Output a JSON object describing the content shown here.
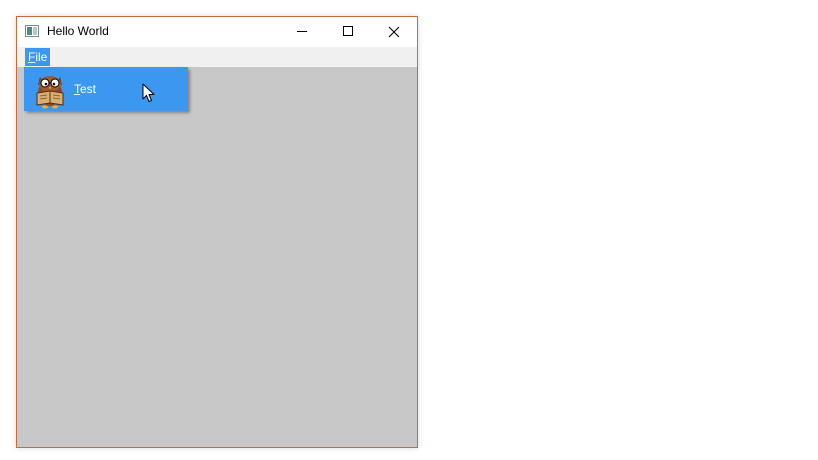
{
  "window": {
    "title": "Hello World",
    "icon": "app-window-icon",
    "controls": [
      "minimize-icon",
      "maximize-icon",
      "close-icon"
    ],
    "frame_color": "#c96a3a",
    "client_color": "#c8c8c8"
  },
  "menubar": {
    "file": {
      "accel": "F",
      "rest": "ile"
    }
  },
  "dropdown": {
    "items": [
      {
        "accel": "T",
        "rest": "est",
        "icon": "reading-owl-icon"
      }
    ],
    "highlight_color": "#3c97f0"
  },
  "cursor": "arrow-cursor-icon"
}
